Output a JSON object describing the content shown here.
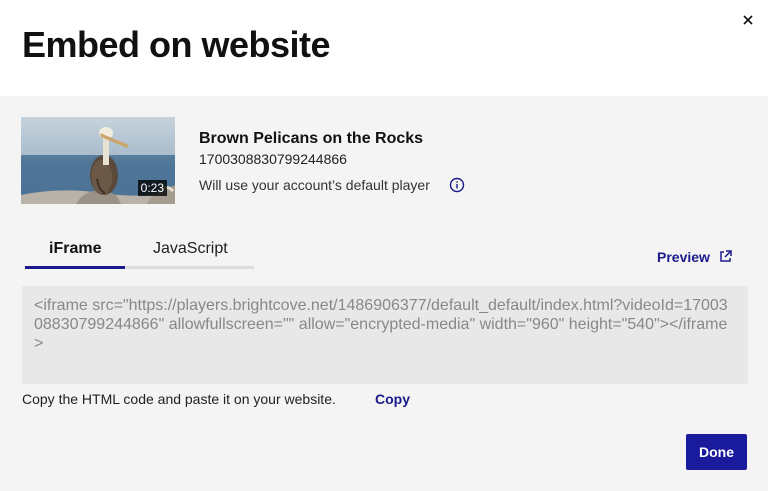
{
  "dialog": {
    "title": "Embed on website",
    "close_icon": "close-icon"
  },
  "video": {
    "title": "Brown Pelicans on the Rocks",
    "id": "1700308830799244866",
    "duration": "0:23",
    "player_note": "Will use your account’s default player"
  },
  "tabs": [
    {
      "label": "iFrame",
      "active": true
    },
    {
      "label": "JavaScript",
      "active": false
    }
  ],
  "preview": {
    "label": "Preview"
  },
  "code": "<iframe src=\"https://players.brightcove.net/1486906377/default_default/index.html?videoId=1700308830799244866\" allowfullscreen=\"\" allow=\"encrypted-media\" width=\"960\" height=\"540\"></iframe>",
  "instructions": {
    "text": "Copy the HTML code and paste it on your website.",
    "copy_label": "Copy"
  },
  "footer": {
    "done_label": "Done"
  },
  "colors": {
    "accent": "#1a1a9c",
    "code_background": "#e8e8e8",
    "body_background": "#f4f4f4"
  }
}
